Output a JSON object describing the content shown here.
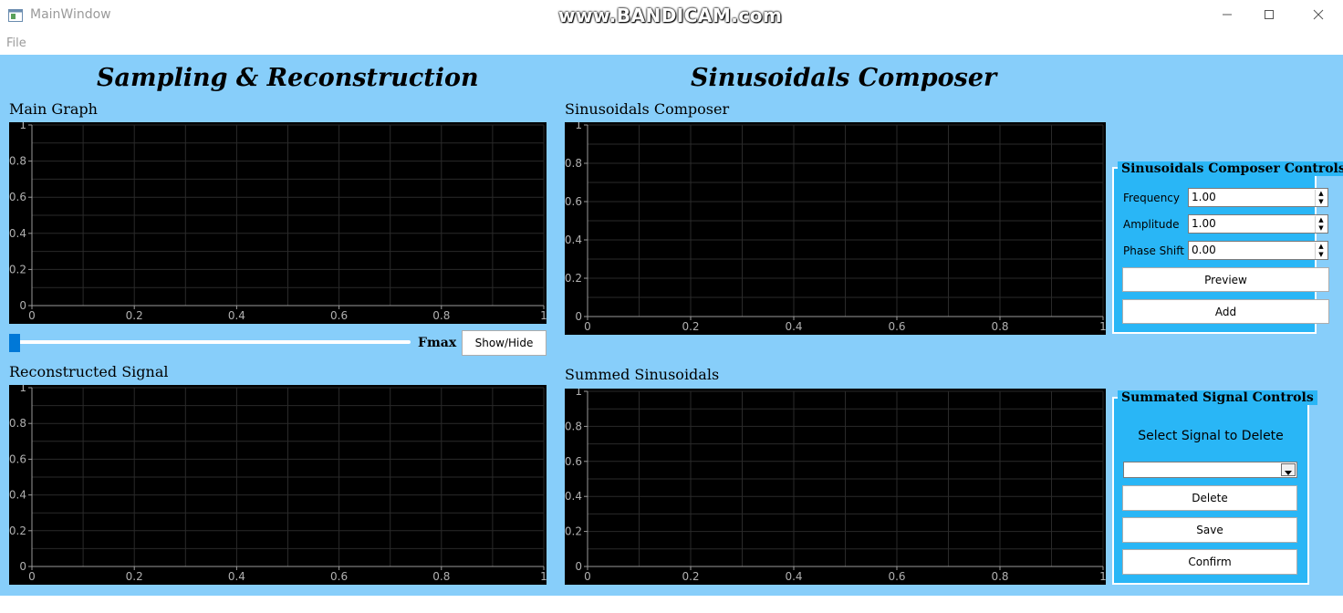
{
  "window": {
    "title": "MainWindow",
    "watermark": "www.BANDICAM.com"
  },
  "menu": {
    "file": "File"
  },
  "left": {
    "heading": "Sampling & Reconstruction",
    "main_graph_label": "Main Graph",
    "slider_value": 0,
    "fmax_label": "Fmax",
    "show_hide_label": "Show/Hide",
    "reconstructed_label": "Reconstructed Signal"
  },
  "right": {
    "heading": "Sinusoidals Composer",
    "composer_label": "Sinusoidals Composer",
    "summed_label": "Summed Sinusoidals"
  },
  "composer_controls": {
    "title": "Sinusoidals Composer Controls",
    "frequency_label": "Frequency",
    "frequency_value": "1.00",
    "amplitude_label": "Amplitude",
    "amplitude_value": "1.00",
    "phase_label": "Phase Shift",
    "phase_value": "0.00",
    "preview_label": "Preview",
    "add_label": "Add"
  },
  "summed_controls": {
    "title": "Summated Signal Controls",
    "select_label": "Select Signal to Delete",
    "select_value": "",
    "delete_label": "Delete",
    "save_label": "Save",
    "confirm_label": "Confirm"
  },
  "chart_data": [
    {
      "type": "line",
      "name_ref": "Main Graph",
      "x_ticks": [
        "0",
        "0.2",
        "0.4",
        "0.6",
        "0.8",
        "1"
      ],
      "y_ticks": [
        "0",
        "0.2",
        "0.4",
        "0.6",
        "0.8",
        "1"
      ],
      "xlim": [
        0,
        1
      ],
      "ylim": [
        0,
        1
      ],
      "grid": true,
      "series": []
    },
    {
      "type": "line",
      "name_ref": "Reconstructed Signal",
      "x_ticks": [
        "0",
        "0.2",
        "0.4",
        "0.6",
        "0.8",
        "1"
      ],
      "y_ticks": [
        "0",
        "0.2",
        "0.4",
        "0.6",
        "0.8",
        "1"
      ],
      "xlim": [
        0,
        1
      ],
      "ylim": [
        0,
        1
      ],
      "grid": true,
      "series": []
    },
    {
      "type": "line",
      "name_ref": "Sinusoidals Composer",
      "x_ticks": [
        "0",
        "0.2",
        "0.4",
        "0.6",
        "0.8",
        "1"
      ],
      "y_ticks": [
        "0",
        "0.2",
        "0.4",
        "0.6",
        "0.8",
        "1"
      ],
      "xlim": [
        0,
        1
      ],
      "ylim": [
        0,
        1
      ],
      "grid": true,
      "series": []
    },
    {
      "type": "line",
      "name_ref": "Summed Sinusoidals",
      "x_ticks": [
        "0",
        "0.2",
        "0.4",
        "0.6",
        "0.8",
        "1"
      ],
      "y_ticks": [
        "0",
        "0.2",
        "0.4",
        "0.6",
        "0.8",
        "1"
      ],
      "xlim": [
        0,
        1
      ],
      "ylim": [
        0,
        1
      ],
      "grid": true,
      "series": []
    }
  ]
}
